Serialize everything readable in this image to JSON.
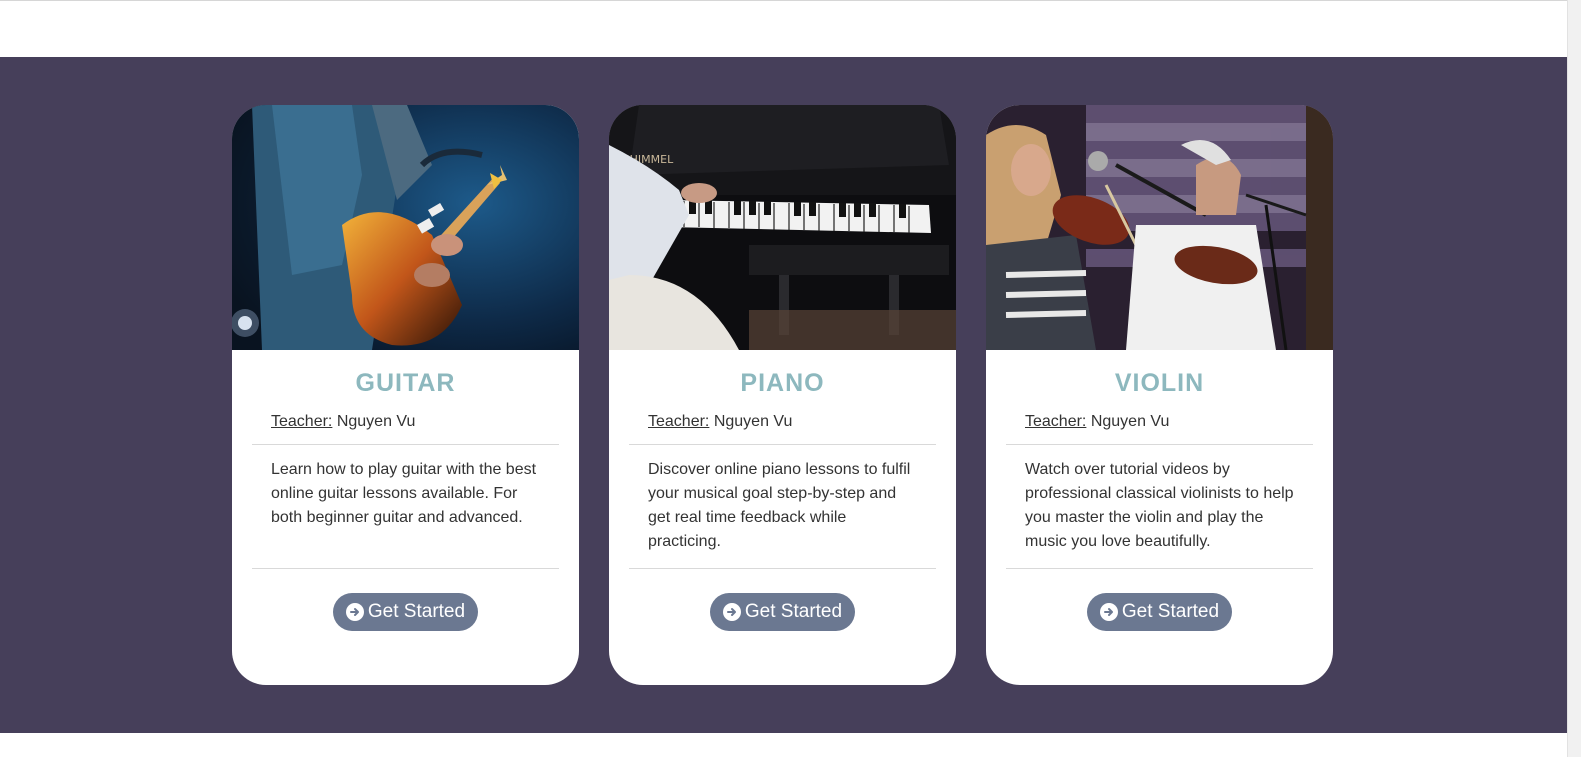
{
  "colors": {
    "section_bg": "#463f5a",
    "title_color": "#8db8be",
    "button_bg": "#6b7891"
  },
  "cards": [
    {
      "title": "GUITAR",
      "teacher_label": "Teacher:",
      "teacher_name": " Nguyen Vu",
      "description": "Learn how to play guitar with the best online guitar lessons available. For both beginner guitar and advanced.",
      "button_label": "Get Started",
      "image": "guitar-photo"
    },
    {
      "title": "PIANO",
      "teacher_label": "Teacher:",
      "teacher_name": " Nguyen Vu",
      "description": "Discover online piano lessons to fulfil your musical goal step-by-step and get real time feedback while practicing.",
      "button_label": "Get Started",
      "image": "piano-photo"
    },
    {
      "title": "VIOLIN",
      "teacher_label": "Teacher:",
      "teacher_name": " Nguyen Vu",
      "description": "Watch over tutorial videos by professional classical violinists to help you master the violin and play the music you love beautifully.",
      "button_label": "Get Started",
      "image": "violin-photo"
    }
  ],
  "piano_brand_text": "SCHIMMEL"
}
